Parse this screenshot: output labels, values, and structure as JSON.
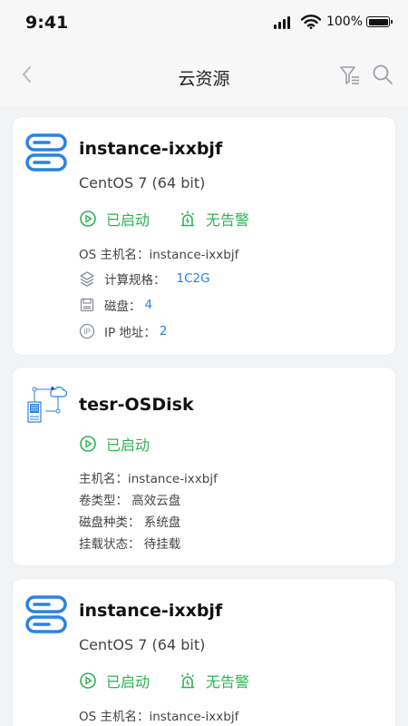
{
  "status_bar": {
    "time": "9:41",
    "battery": "100%"
  },
  "nav": {
    "title": "云资源",
    "back_icon": "chevron-left-icon",
    "filter_icon": "filter-icon",
    "search_icon": "search-icon"
  },
  "colors": {
    "accent_blue": "#2a82e4",
    "status_green": "#2eb352"
  },
  "cards": [
    {
      "icon": "server-icon",
      "title": "instance-ixxbjf",
      "subtitle": "CentOS 7 (64 bit)",
      "status": "已启动",
      "alarm": "无告警",
      "os_host_label": "OS 主机名：instance-ixxbjf",
      "spec_label": "计算规格：",
      "spec_value": "1C2G",
      "disk_label": "磁盘：",
      "disk_value": "4",
      "ip_label": "IP 地址：",
      "ip_value": "2"
    },
    {
      "icon": "cloud-disk-icon",
      "title": "tesr-OSDisk",
      "status": "已启动",
      "host": "主机名：instance-ixxbjf",
      "volume_type": "卷类型：  高效云盘",
      "disk_kind": "磁盘种类：  系统盘",
      "mount_state": "挂载状态：  待挂载"
    },
    {
      "icon": "server-icon",
      "title": "instance-ixxbjf",
      "subtitle": "CentOS 7 (64 bit)",
      "status": "已启动",
      "alarm": "无告警",
      "os_host_label": "OS 主机名：instance-ixxbjf"
    }
  ]
}
